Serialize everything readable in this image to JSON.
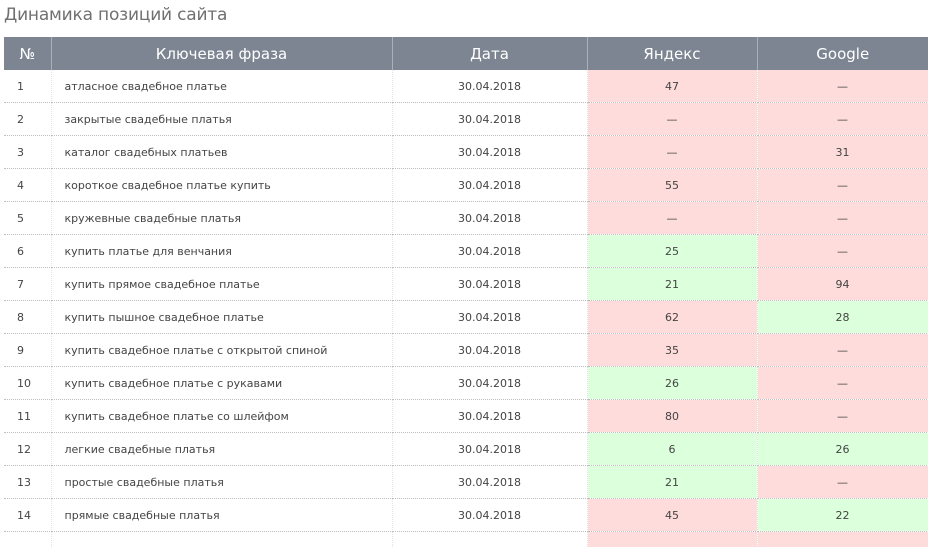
{
  "page": {
    "title": "Динамика позиций сайта"
  },
  "colors": {
    "header_bg": "#7c8591",
    "bad_bg": "#ffdcdc",
    "good_bg": "#dcffdc"
  },
  "table": {
    "headers": {
      "num": "№",
      "phrase": "Ключевая фраза",
      "date": "Дата",
      "yandex": "Яндекс",
      "google": "Google"
    },
    "rows": [
      {
        "num": "1",
        "phrase": "атласное свадебное платье",
        "date": "30.04.2018",
        "yandex": "47",
        "yandex_status": "bad",
        "google": "—",
        "google_status": "bad"
      },
      {
        "num": "2",
        "phrase": "закрытые свадебные платья",
        "date": "30.04.2018",
        "yandex": "—",
        "yandex_status": "bad",
        "google": "—",
        "google_status": "bad"
      },
      {
        "num": "3",
        "phrase": "каталог свадебных платьев",
        "date": "30.04.2018",
        "yandex": "—",
        "yandex_status": "bad",
        "google": "31",
        "google_status": "bad"
      },
      {
        "num": "4",
        "phrase": "короткое свадебное платье купить",
        "date": "30.04.2018",
        "yandex": "55",
        "yandex_status": "bad",
        "google": "—",
        "google_status": "bad"
      },
      {
        "num": "5",
        "phrase": "кружевные свадебные платья",
        "date": "30.04.2018",
        "yandex": "—",
        "yandex_status": "bad",
        "google": "—",
        "google_status": "bad"
      },
      {
        "num": "6",
        "phrase": "купить платье для венчания",
        "date": "30.04.2018",
        "yandex": "25",
        "yandex_status": "good",
        "google": "—",
        "google_status": "bad"
      },
      {
        "num": "7",
        "phrase": "купить прямое свадебное платье",
        "date": "30.04.2018",
        "yandex": "21",
        "yandex_status": "good",
        "google": "94",
        "google_status": "bad"
      },
      {
        "num": "8",
        "phrase": "купить пышное свадебное платье",
        "date": "30.04.2018",
        "yandex": "62",
        "yandex_status": "bad",
        "google": "28",
        "google_status": "good"
      },
      {
        "num": "9",
        "phrase": "купить свадебное платье с открытой спиной",
        "date": "30.04.2018",
        "yandex": "35",
        "yandex_status": "bad",
        "google": "—",
        "google_status": "bad"
      },
      {
        "num": "10",
        "phrase": "купить свадебное платье с рукавами",
        "date": "30.04.2018",
        "yandex": "26",
        "yandex_status": "good",
        "google": "—",
        "google_status": "bad"
      },
      {
        "num": "11",
        "phrase": "купить свадебное платье со шлейфом",
        "date": "30.04.2018",
        "yandex": "80",
        "yandex_status": "bad",
        "google": "—",
        "google_status": "bad"
      },
      {
        "num": "12",
        "phrase": "легкие свадебные платья",
        "date": "30.04.2018",
        "yandex": "6",
        "yandex_status": "good",
        "google": "26",
        "google_status": "good"
      },
      {
        "num": "13",
        "phrase": "простые свадебные платья",
        "date": "30.04.2018",
        "yandex": "21",
        "yandex_status": "good",
        "google": "—",
        "google_status": "bad"
      },
      {
        "num": "14",
        "phrase": "прямые свадебные платья",
        "date": "30.04.2018",
        "yandex": "45",
        "yandex_status": "bad",
        "google": "22",
        "google_status": "good"
      }
    ],
    "partial_row": {
      "yandex_status": "bad",
      "google_status": "bad"
    }
  }
}
